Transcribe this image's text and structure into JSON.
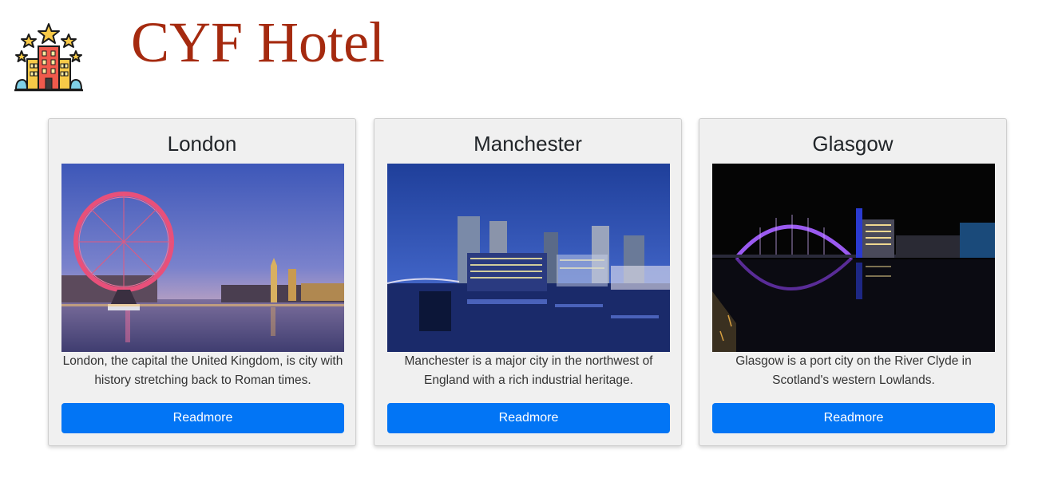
{
  "header": {
    "brand": "CYF Hotel",
    "logo_icon": "hotel-stars-icon"
  },
  "cities": [
    {
      "name": "London",
      "description": "London, the capital the United Kingdom, is city with history stretching back to Roman times.",
      "button_label": "Readmore",
      "image": "london-eye-thames-dusk"
    },
    {
      "name": "Manchester",
      "description": "Manchester is a major city in the northwest of England with a rich industrial heritage.",
      "button_label": "Readmore",
      "image": "manchester-mediacity-night"
    },
    {
      "name": "Glasgow",
      "description": "Glasgow is a port city on the River Clyde in Scotland's western Lowlands.",
      "button_label": "Readmore",
      "image": "glasgow-clyde-arc-night"
    }
  ],
  "colors": {
    "brand": "#a52a0f",
    "button": "#0275f5",
    "card_bg": "#f0f0f0"
  }
}
